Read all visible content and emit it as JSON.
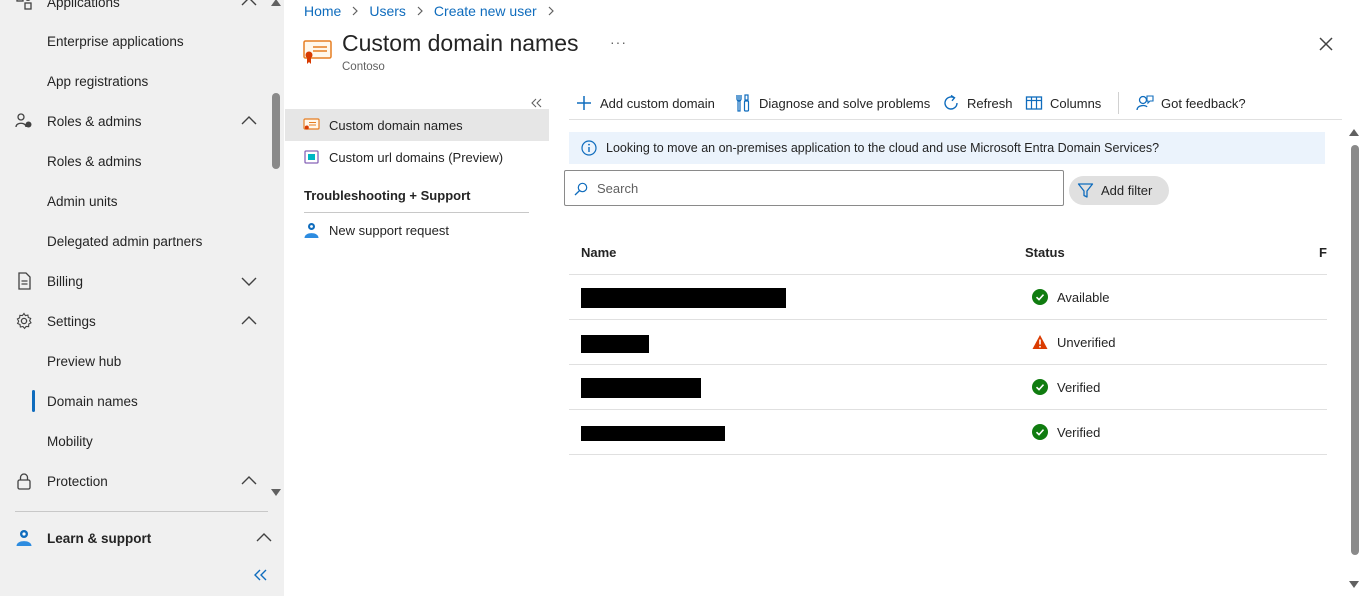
{
  "nav": {
    "items": [
      {
        "label": "Applications",
        "icon": "applications-icon",
        "chevron": "up"
      },
      {
        "label": "Enterprise applications",
        "sub": true
      },
      {
        "label": "App registrations",
        "sub": true
      },
      {
        "label": "Roles & admins",
        "icon": "roles-icon",
        "chevron": "up"
      },
      {
        "label": "Roles & admins",
        "sub": true
      },
      {
        "label": "Admin units",
        "sub": true
      },
      {
        "label": "Delegated admin partners",
        "sub": true
      },
      {
        "label": "Billing",
        "icon": "billing-icon",
        "chevron": "down"
      },
      {
        "label": "Settings",
        "icon": "gear-icon",
        "chevron": "up"
      },
      {
        "label": "Preview hub",
        "sub": true
      },
      {
        "label": "Domain names",
        "sub": true,
        "active": true
      },
      {
        "label": "Mobility",
        "sub": true
      },
      {
        "label": "Protection",
        "icon": "lock-icon",
        "chevron": "up"
      }
    ],
    "learn_support": "Learn & support"
  },
  "breadcrumb": [
    "Home",
    "Users",
    "Create new user"
  ],
  "header": {
    "title": "Custom domain names",
    "subtitle": "Contoso",
    "more": "···"
  },
  "blade_menu": {
    "items": [
      {
        "label": "Custom domain names",
        "selected": true
      },
      {
        "label": "Custom url domains (Preview)"
      }
    ],
    "section": "Troubleshooting + Support",
    "support_item": "New support request"
  },
  "commands": {
    "add": "Add custom domain",
    "diagnose": "Diagnose and solve problems",
    "refresh": "Refresh",
    "columns": "Columns",
    "feedback": "Got feedback?"
  },
  "info_banner": "Looking to move an on-premises application to the cloud and use Microsoft Entra Domain Services?",
  "search": {
    "placeholder": "Search"
  },
  "filter_label": "Add filter",
  "table": {
    "columns": [
      "Name",
      "Status",
      "Fe"
    ],
    "rows": [
      {
        "status": "Available",
        "status_type": "ok"
      },
      {
        "status": "Unverified",
        "status_type": "warning"
      },
      {
        "status": "Verified",
        "status_type": "ok"
      },
      {
        "status": "Verified",
        "status_type": "ok"
      }
    ]
  },
  "colors": {
    "accent": "#0f6cbd",
    "success": "#107c10",
    "warning": "#bc2f32",
    "nav_bg": "#f0f0f0"
  }
}
